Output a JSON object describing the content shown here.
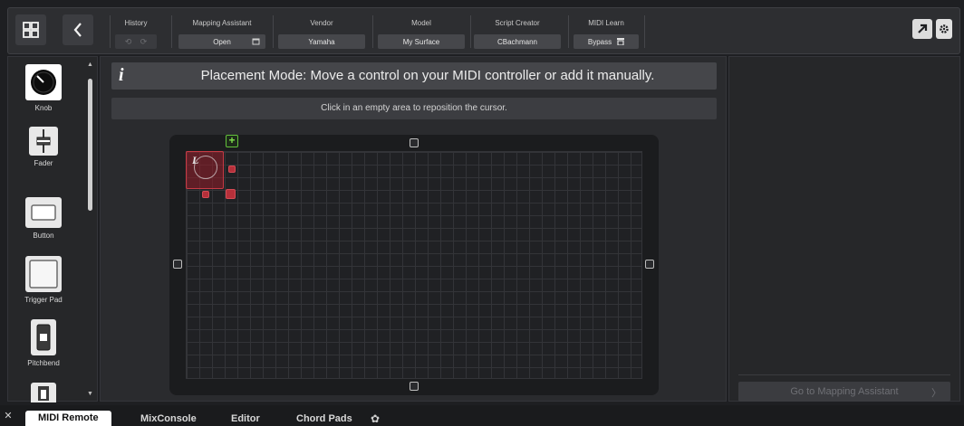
{
  "toolbar": {
    "history": {
      "label": "History",
      "undo": "⟲",
      "redo": "⟳"
    },
    "mapping_assistant": {
      "label": "Mapping Assistant",
      "value": "Open"
    },
    "vendor": {
      "label": "Vendor",
      "value": "Yamaha"
    },
    "model": {
      "label": "Model",
      "value": "My Surface"
    },
    "script_creator": {
      "label": "Script Creator",
      "value": "CBachmann"
    },
    "midi_learn": {
      "label": "MIDI Learn",
      "value": "Bypass"
    }
  },
  "palette": {
    "items": [
      {
        "label": "Knob",
        "icon": "knob-icon",
        "selected": true
      },
      {
        "label": "Fader",
        "icon": "fader-icon"
      },
      {
        "label": "Button",
        "icon": "button-icon"
      },
      {
        "label": "Trigger Pad",
        "icon": "trigger-pad-icon"
      },
      {
        "label": "Pitchbend",
        "icon": "pitchbend-icon"
      },
      {
        "label": "",
        "icon": "modwheel-icon"
      }
    ]
  },
  "main": {
    "info_icon": "i",
    "info_text": "Placement Mode: Move a control on your MIDI controller or add it manually.",
    "hint_text": "Click in an empty area to reposition the cursor.",
    "knob_glyph": "L"
  },
  "right_panel": {
    "go_button": "Go to Mapping Assistant",
    "go_chevron": "〉"
  },
  "tabs": [
    {
      "label": "MIDI Remote",
      "active": true
    },
    {
      "label": "MixConsole"
    },
    {
      "label": "Editor"
    },
    {
      "label": "Chord Pads"
    }
  ],
  "colors": {
    "accent_green": "#63c13b",
    "selection_red": "#c63a44",
    "background": "#1e1f22"
  }
}
